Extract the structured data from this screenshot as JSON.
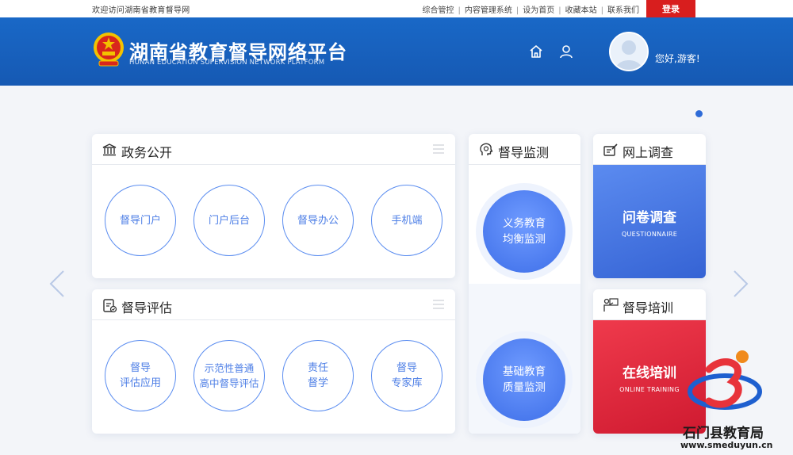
{
  "topbar": {
    "notice": "欢迎访问湖南省教育督导网",
    "nav": [
      "综合管控",
      "内容管理系统",
      "设为首页",
      "收藏本站",
      "联系我们"
    ],
    "login_label": "登录"
  },
  "header": {
    "title": "湖南省教育督导网络平台",
    "subtitle": "HUNAN EDUCATION SUPERVISION NETWORK PLATFORM",
    "greeting": "您好,游客!"
  },
  "cards": {
    "affairs": {
      "title": "政务公开",
      "items": [
        "督导门户",
        "门户后台",
        "督导办公",
        "手机端"
      ]
    },
    "evaluation": {
      "title": "督导评估",
      "items": [
        {
          "line1": "督导",
          "line2": "评估应用"
        },
        {
          "line1": "示范性普通",
          "line2": "高中督导评估"
        },
        {
          "line1": "责任",
          "line2": "督学"
        },
        {
          "line1": "督导",
          "line2": "专家库"
        }
      ]
    },
    "monitoring": {
      "title": "督导监测",
      "items": [
        {
          "line1": "义务教育",
          "line2": "均衡监测"
        },
        {
          "line1": "基础教育",
          "line2": "质量监测"
        }
      ]
    },
    "survey": {
      "title": "网上调查",
      "promo": "问卷调查",
      "promo_en": "QUESTIONNAIRE",
      "color": "#3f72dd"
    },
    "training": {
      "title": "督导培训",
      "promo": "在线培训",
      "promo_en": "ONLINE TRAINING",
      "color": "#e2243a"
    }
  },
  "watermark": {
    "name": "石门县教育局",
    "url": "www.smeduyun.cn"
  }
}
